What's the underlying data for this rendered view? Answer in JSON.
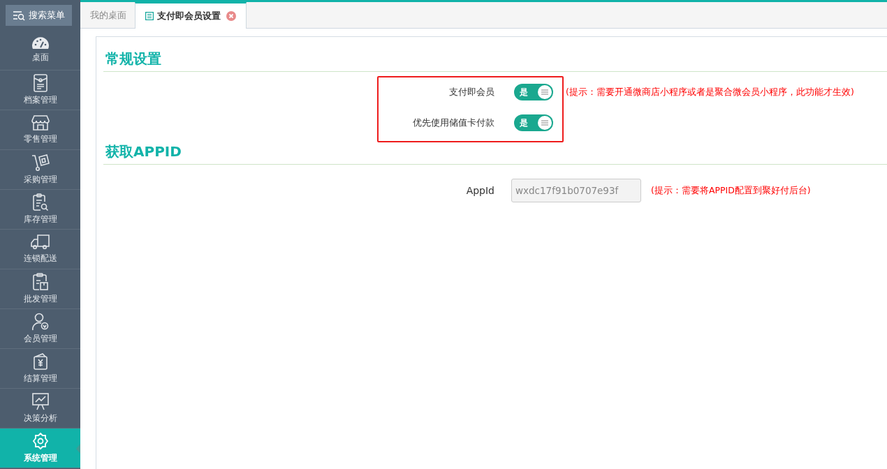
{
  "sidebar": {
    "search_button": "搜索菜单",
    "items": [
      {
        "label": "桌面",
        "selected": false
      },
      {
        "label": "档案管理",
        "selected": false
      },
      {
        "label": "零售管理",
        "selected": false
      },
      {
        "label": "采购管理",
        "selected": false
      },
      {
        "label": "库存管理",
        "selected": false
      },
      {
        "label": "连锁配送",
        "selected": false
      },
      {
        "label": "批发管理",
        "selected": false
      },
      {
        "label": "会员管理",
        "selected": false
      },
      {
        "label": "结算管理",
        "selected": false
      },
      {
        "label": "决策分析",
        "selected": false
      },
      {
        "label": "系统管理",
        "selected": true
      }
    ]
  },
  "tabs": [
    {
      "label": "我的桌面",
      "selected": false,
      "closable": false
    },
    {
      "label": "支付即会员设置",
      "selected": true,
      "closable": true
    }
  ],
  "sections": [
    {
      "title": "常规设置",
      "rows": [
        {
          "kind": "switch",
          "label": "支付即会员",
          "on": true,
          "switch_text": "是",
          "hint": "(提示：需要开通微商店小程序或者是聚合微会员小程序，此功能才生效)"
        },
        {
          "kind": "switch",
          "label": "优先使用储值卡付款",
          "on": true,
          "switch_text": "是"
        }
      ]
    },
    {
      "title": "获取APPID",
      "rows": [
        {
          "kind": "input",
          "label": "AppId",
          "value": "wxdc17f91b0707e93f",
          "disabled": true,
          "hint": "(提示：需要将APPID配置到聚好付后台)"
        }
      ]
    }
  ]
}
